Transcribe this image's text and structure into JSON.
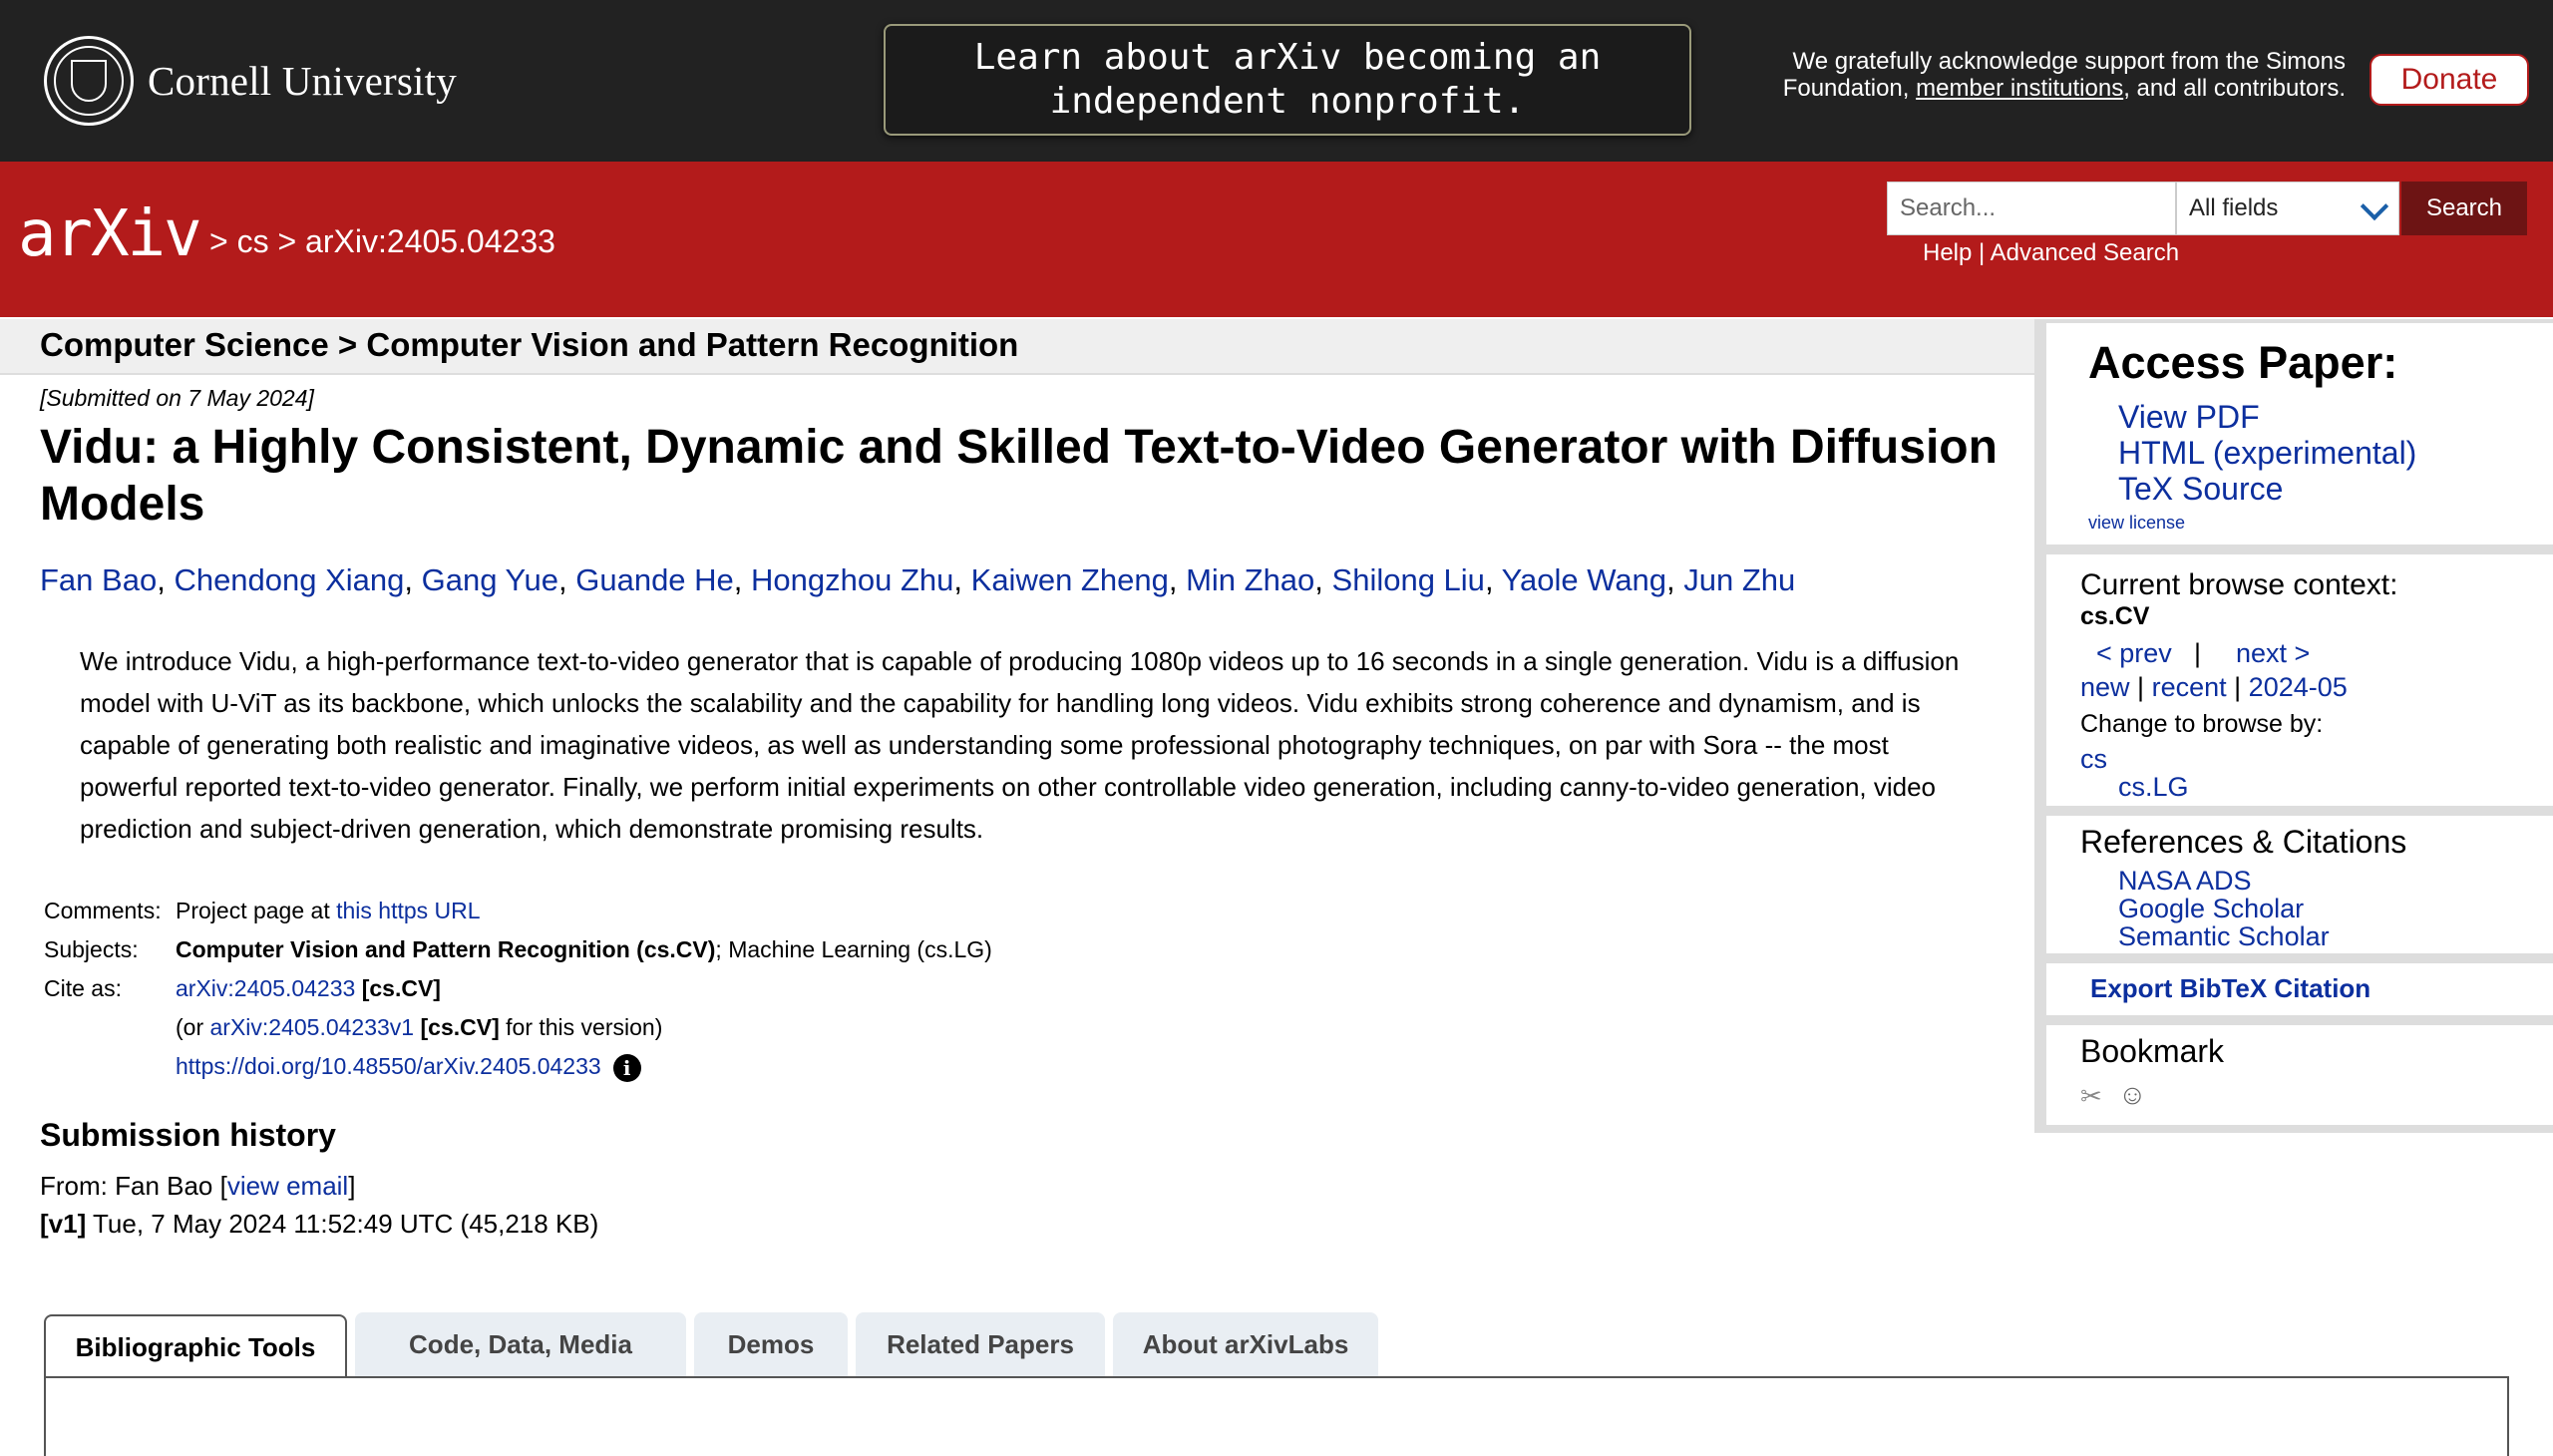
{
  "top_bar": {
    "cornell_name": "Cornell University",
    "announcement": "Learn about arXiv becoming an independent nonprofit.",
    "ack_text_1": "We gratefully acknowledge support from the Simons Foundation, ",
    "ack_link": "member institutions",
    "ack_text_2": ", and all contributors.",
    "donate_label": "Donate"
  },
  "header": {
    "logo_text": "arXiv",
    "breadcrumb": "> cs > arXiv:2405.04233",
    "search_placeholder": "Search...",
    "field_select": "All fields",
    "search_button": "Search",
    "help_link": "Help",
    "separator": " | ",
    "advanced_search": "Advanced Search"
  },
  "main": {
    "subject_header": "Computer Science > Computer Vision and Pattern Recognition",
    "submitted": "[Submitted on 7 May 2024]",
    "title": "Vidu: a Highly Consistent, Dynamic and Skilled Text-to-Video Generator with Diffusion Models",
    "authors": [
      "Fan Bao",
      "Chendong Xiang",
      "Gang Yue",
      "Guande He",
      "Hongzhou Zhu",
      "Kaiwen Zheng",
      "Min Zhao",
      "Shilong Liu",
      "Yaole Wang",
      "Jun Zhu"
    ],
    "abstract": "We introduce Vidu, a high-performance text-to-video generator that is capable of producing 1080p videos up to 16 seconds in a single generation. Vidu is a diffusion model with U-ViT as its backbone, which unlocks the scalability and the capability for handling long videos. Vidu exhibits strong coherence and dynamism, and is capable of generating both realistic and imaginative videos, as well as understanding some professional photography techniques, on par with Sora -- the most powerful reported text-to-video generator. Finally, we perform initial experiments on other controllable video generation, including canny-to-video generation, video prediction and subject-driven generation, which demonstrate promising results.",
    "comments_label": "Comments:",
    "comments_text": "Project page at ",
    "comments_link": "this https URL",
    "subjects_label": "Subjects:",
    "subjects_primary": "Computer Vision and Pattern Recognition (cs.CV)",
    "subjects_secondary": "; Machine Learning (cs.LG)",
    "cite_label": "Cite as:",
    "cite_id": "arXiv:2405.04233",
    "cite_tag": " [cs.CV]",
    "cite_or_prefix": "(or ",
    "cite_version_id": "arXiv:2405.04233v1",
    "cite_version_tag": " [cs.CV]",
    "cite_version_suffix": " for this version)",
    "doi": "https://doi.org/10.48550/arXiv.2405.04233",
    "submission_history_heading": "Submission history",
    "from_prefix": "From: Fan Bao [",
    "view_email": "view email",
    "from_suffix": "]",
    "v1_label": "[v1]",
    "v1_text": " Tue, 7 May 2024 11:52:49 UTC (45,218 KB)"
  },
  "tabs": [
    "Bibliographic Tools",
    "Code, Data, Media",
    "Demos",
    "Related Papers",
    "About arXivLabs"
  ],
  "sidebar": {
    "access_heading": "Access Paper:",
    "view_pdf": "View PDF",
    "html_experimental": "HTML (experimental)",
    "tex_source": "TeX Source",
    "view_license": "view license",
    "browse_heading": "Current browse context:",
    "browse_context": "cs.CV",
    "prev": "< prev",
    "pipe": "|",
    "next": "next >",
    "new": "new",
    "recent": "recent",
    "date": "2024-05",
    "change_browse": "Change to browse by:",
    "browse_cs": "cs",
    "browse_lg": "cs.LG",
    "refs_heading": "References & Citations",
    "nasa": "NASA ADS",
    "scholar": "Google Scholar",
    "semantic": "Semantic Scholar",
    "export_bibtex": "Export BibTeX Citation",
    "bookmark_heading": "Bookmark"
  }
}
